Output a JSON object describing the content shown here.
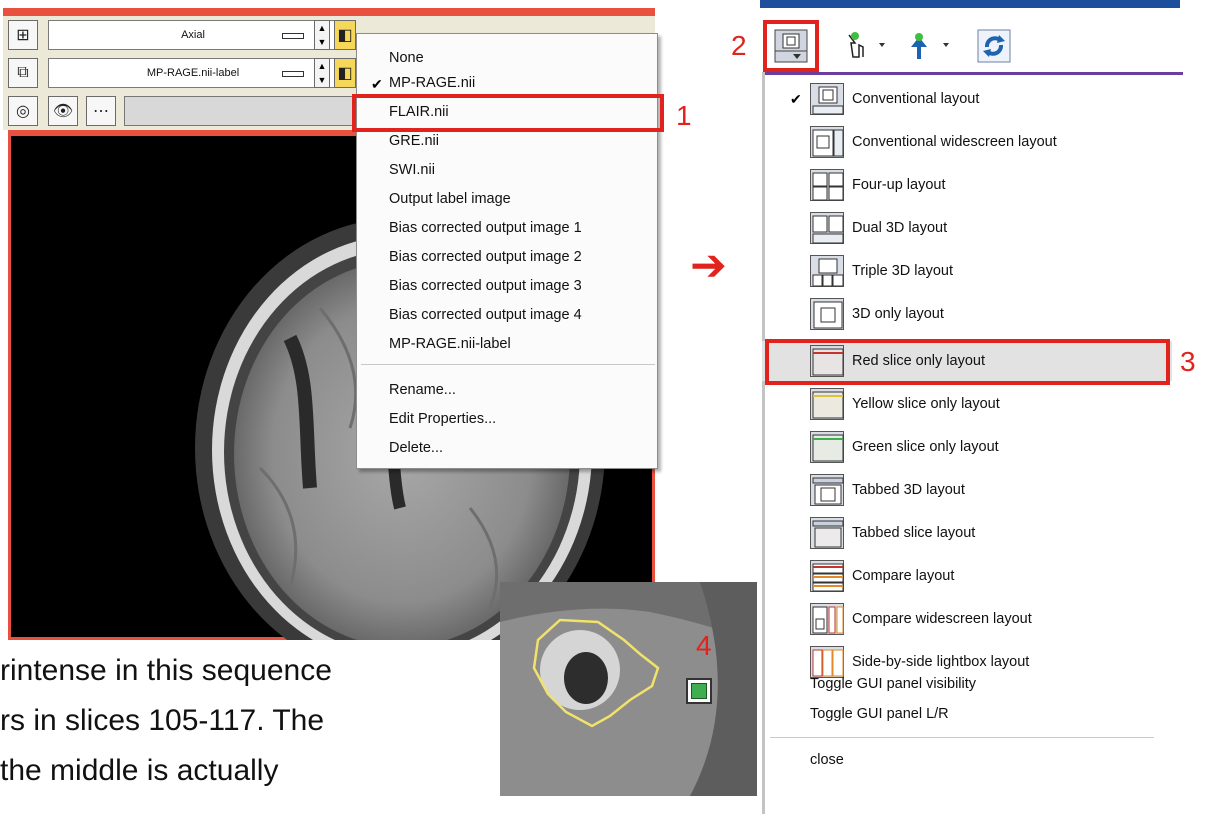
{
  "viewer": {
    "orientation": "Axial",
    "label_volume": "MP-RAGE.nii-label"
  },
  "volume_menu": {
    "items": [
      {
        "label": "None",
        "checked": false
      },
      {
        "label": "MP-RAGE.nii",
        "checked": true
      },
      {
        "label": "FLAIR.nii",
        "checked": false
      },
      {
        "label": "GRE.nii",
        "checked": false
      },
      {
        "label": "SWI.nii",
        "checked": false
      },
      {
        "label": "Output label image",
        "checked": false
      },
      {
        "label": "Bias corrected output image 1",
        "checked": false
      },
      {
        "label": "Bias corrected output image 2",
        "checked": false
      },
      {
        "label": "Bias corrected output image 3",
        "checked": false
      },
      {
        "label": "Bias corrected output image 4",
        "checked": false
      },
      {
        "label": "MP-RAGE.nii-label",
        "checked": false
      }
    ],
    "actions": [
      "Rename...",
      "Edit Properties...",
      "Delete..."
    ],
    "check_mark": "✔"
  },
  "layout_menu": {
    "items": [
      {
        "label": "Conventional layout",
        "checked": true
      },
      {
        "label": "Conventional widescreen layout",
        "checked": false
      },
      {
        "label": "Four-up layout",
        "checked": false
      },
      {
        "label": "Dual 3D layout",
        "checked": false
      },
      {
        "label": "Triple 3D layout",
        "checked": false
      },
      {
        "label": "3D only layout",
        "checked": false
      },
      {
        "label": "Red slice only layout",
        "checked": false
      },
      {
        "label": "Yellow slice only layout",
        "checked": false
      },
      {
        "label": "Green slice only layout",
        "checked": false
      },
      {
        "label": "Tabbed 3D layout",
        "checked": false
      },
      {
        "label": "Tabbed slice layout",
        "checked": false
      },
      {
        "label": "Compare layout",
        "checked": false
      },
      {
        "label": "Compare widescreen layout",
        "checked": false
      },
      {
        "label": "Side-by-side lightbox layout",
        "checked": false
      }
    ],
    "toggles": [
      "Toggle GUI panel visibility",
      "Toggle GUI panel L/R"
    ],
    "close": "close",
    "check_mark": "✔"
  },
  "annotations": {
    "n1": "1",
    "n2": "2",
    "n3": "3",
    "n4": "4",
    "arrow": "➔"
  },
  "caption": {
    "line1": "rintense in this sequence",
    "line2": "rs in slices 105-117. The",
    "line3": "the    middle    is    actually"
  },
  "colors": {
    "annotation_red": "#e0231c",
    "viewer_red": "#e8513f",
    "menu_purple": "#6a3fa0",
    "header_blue": "#1d4f9c",
    "segment_yellow": "#f1e26a"
  }
}
